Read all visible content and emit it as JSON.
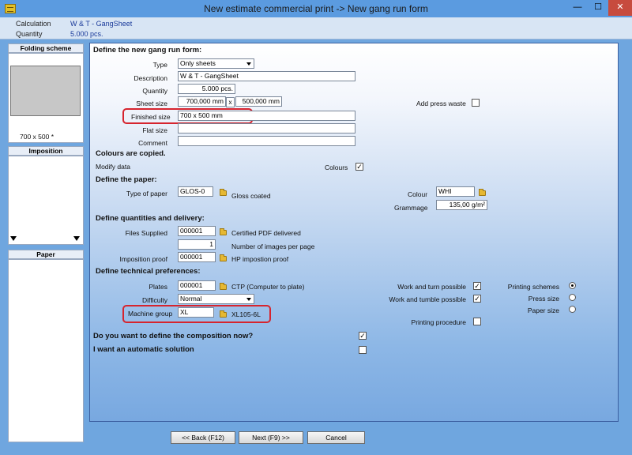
{
  "window": {
    "title": "New estimate commercial print -> New gang run form",
    "minimize_glyph": "—",
    "maximize_glyph": "☐",
    "close_glyph": "✕",
    "icon": "app-icon"
  },
  "info": {
    "calculation_label": "Calculation",
    "calculation_value": "W & T - GangSheet",
    "quantity_label": "Quantity",
    "quantity_value": "5.000 pcs."
  },
  "left": {
    "folding_scheme_title": "Folding scheme",
    "folding_size": "700 x 500 *",
    "imposition_title": "Imposition",
    "paper_title": "Paper"
  },
  "form": {
    "section_gang": "Define the new gang run form:",
    "type_label": "Type",
    "type_value": "Only sheets",
    "description_label": "Description",
    "description_value": "W & T - GangSheet",
    "quantity_label": "Quantity",
    "quantity_value": "5.000 pcs.",
    "sheet_size_label": "Sheet size",
    "sheet_width": "700,000 mm",
    "sheet_x": "x",
    "sheet_height": "500,000 mm",
    "add_press_waste_label": "Add press waste",
    "finished_size_label": "Finished size",
    "finished_size_value": "700 x 500 mm",
    "flat_size_label": "Flat size",
    "flat_size_value": "",
    "comment_label": "Comment",
    "comment_value": "",
    "colours_copied": "Colours are copied.",
    "modify_data_label": "Modify data",
    "colours_label": "Colours",
    "section_paper": "Define the paper:",
    "type_of_paper_label": "Type of paper",
    "type_of_paper_value": "GLOS-0",
    "paper_desc": "Gloss coated",
    "colour_label": "Colour",
    "colour_value": "WHI",
    "grammage_label": "Grammage",
    "grammage_value": "135,00 g/m²",
    "section_quantities": "Define quantities and delivery:",
    "files_supplied_label": "Files Supplied",
    "files_supplied_value": "000001",
    "files_supplied_desc": "Certified PDF delivered",
    "images_per_page_value": "1",
    "images_per_page_label": "Number of images per page",
    "imposition_proof_label": "Imposition proof",
    "imposition_proof_value": "000001",
    "imposition_proof_desc": "HP impostion proof",
    "section_technical": "Define technical preferences:",
    "plates_label": "Plates",
    "plates_value": "000001",
    "plates_desc": "CTP (Computer to plate)",
    "difficulty_label": "Difficulty",
    "difficulty_value": "Normal",
    "machine_group_label": "Machine group",
    "machine_group_value": "XL",
    "machine_group_desc": "XL105-6L",
    "work_turn_label": "Work and turn possible",
    "work_tumble_label": "Work and tumble possible",
    "printing_procedure_label": "Printing procedure",
    "printing_schemes_label": "Printing schemes",
    "press_size_label": "Press size",
    "paper_size_label": "Paper size",
    "composition_question": "Do you want to define the composition now?",
    "automatic_solution": "I want an automatic solution"
  },
  "checks": {
    "add_press_waste": "",
    "colours": "✓",
    "work_turn": "✓",
    "work_tumble": "✓",
    "printing_procedure": "",
    "composition": "✓",
    "automatic": ""
  },
  "buttons": {
    "back": "<< Back (F12)",
    "next": "Next (F9) >>",
    "cancel": "Cancel"
  }
}
